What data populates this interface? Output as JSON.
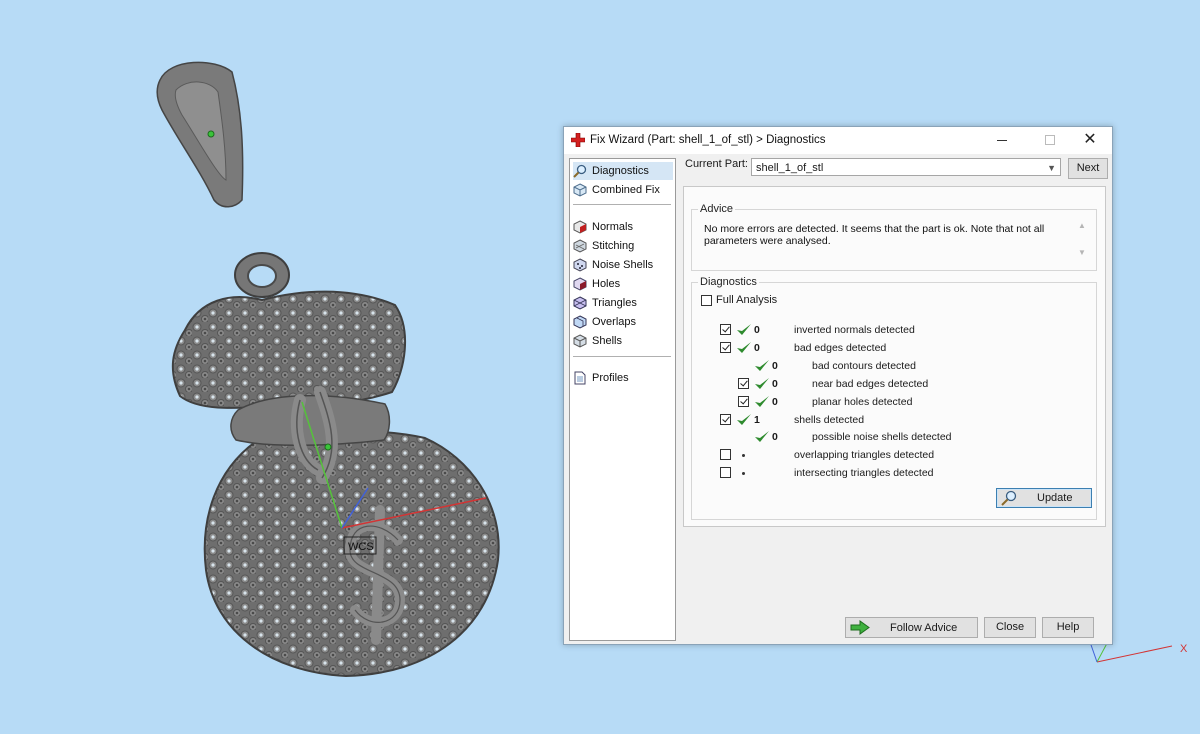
{
  "viewport": {
    "wcs_label": "WCS",
    "corner_axis_x_label": "X",
    "background_color": "#b7dbf6",
    "model_color": "#6f6f6f"
  },
  "dialog": {
    "title": "Fix Wizard (Part: shell_1_of_stl) > Diagnostics",
    "title_icon": "red-cross-icon",
    "window_controls": {
      "close_symbol": "✕"
    },
    "nav": {
      "items": [
        {
          "label": "Diagnostics",
          "icon": "magnifier-icon",
          "selected": true
        },
        {
          "label": "Combined Fix",
          "icon": "cube-icon"
        },
        {
          "label": "Normals",
          "icon": "normals-cube-icon"
        },
        {
          "label": "Stitching",
          "icon": "stitching-icon"
        },
        {
          "label": "Noise Shells",
          "icon": "noise-shells-icon"
        },
        {
          "label": "Holes",
          "icon": "holes-icon"
        },
        {
          "label": "Triangles",
          "icon": "triangles-icon"
        },
        {
          "label": "Overlaps",
          "icon": "overlaps-icon"
        },
        {
          "label": "Shells",
          "icon": "shells-icon"
        },
        {
          "label": "Profiles",
          "icon": "document-icon"
        }
      ]
    },
    "current_part": {
      "label": "Current Part:",
      "value": "shell_1_of_stl",
      "next_label": "Next"
    },
    "advice": {
      "title": "Advice",
      "text": "No more errors are detected. It seems that the part is ok. Note that not all parameters were analysed."
    },
    "diagnostics": {
      "title": "Diagnostics",
      "full_analysis_label": "Full Analysis",
      "full_analysis_checked": false,
      "rows": [
        {
          "checked": true,
          "status": "ok",
          "count": "0",
          "label": "inverted normals detected",
          "indent": 0
        },
        {
          "checked": true,
          "status": "ok",
          "count": "0",
          "label": "bad edges detected",
          "indent": 0
        },
        {
          "checked": null,
          "status": "ok",
          "count": "0",
          "label": "bad contours detected",
          "indent": 1
        },
        {
          "checked": true,
          "status": "ok",
          "count": "0",
          "label": "near bad edges detected",
          "indent": 1
        },
        {
          "checked": true,
          "status": "ok",
          "count": "0",
          "label": "planar holes detected",
          "indent": 1
        },
        {
          "checked": true,
          "status": "ok",
          "count": "1",
          "label": "shells detected",
          "indent": 0
        },
        {
          "checked": null,
          "status": "ok",
          "count": "0",
          "label": "possible noise shells detected",
          "indent": 1
        },
        {
          "checked": false,
          "status": "dot",
          "count": "",
          "label": "overlapping triangles detected",
          "indent": 0
        },
        {
          "checked": false,
          "status": "dot",
          "count": "",
          "label": "intersecting triangles detected",
          "indent": 0
        }
      ],
      "update_label": "Update"
    },
    "footer": {
      "follow_advice_label": "Follow Advice",
      "close_label": "Close",
      "help_label": "Help"
    },
    "colors": {
      "ok_check": "#2e8b2e",
      "accent_border": "#3c7fb1"
    }
  }
}
